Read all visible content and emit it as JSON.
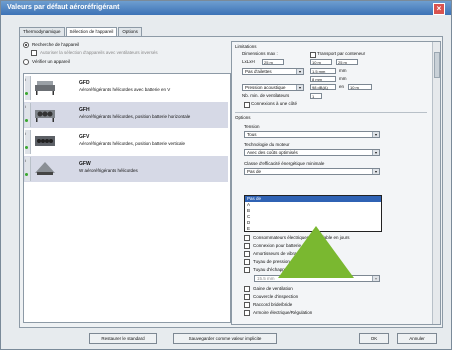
{
  "window": {
    "title": "Valeurs par défaut aéroréfrigérant"
  },
  "tabs": [
    {
      "label": "Thermodynamique"
    },
    {
      "label": "Sélection de l'appareil"
    },
    {
      "label": "Options"
    }
  ],
  "left": {
    "radio_search": "Recherche de l'appareil",
    "subcheck": "Autoriser la sélection d'appareils avec ventilateurs inversés",
    "radio_verify": "Vérifier un appareil",
    "items": [
      {
        "code": "GFD",
        "desc": "Aéroréfrigérants hélicoïdes avec batterie en V"
      },
      {
        "code": "GFH",
        "desc": "Aéroréfrigérants hélicoïdes, position batterie horizontale"
      },
      {
        "code": "GFV",
        "desc": "Aéroréfrigérants hélicoïdes, position batterie verticale"
      },
      {
        "code": "GFW",
        "desc": "W aéroréfrigérants hélicoïdes"
      }
    ]
  },
  "right": {
    "limits_title": "Limitations",
    "dim_max": "Dimensions max :",
    "transport": "Transport par conteneur",
    "lxlxh": "LxLxH",
    "v1": "25 m",
    "v2": "10 m",
    "v3": "25 m",
    "par_ailettes": "Pas d'ailettes",
    "pas_val": "1.5 mm",
    "mm1": "mm",
    "min_val": "8 mm",
    "mm2": "mm",
    "pression": "Pression acoustique",
    "press_val": "98 dB(A)",
    "at_label": "en",
    "dist_val": "10 m",
    "ventilateurs": "Nb. min. de ventilateurs",
    "vent_val": "1",
    "connexions": "Connexions à une côté",
    "options_title": "Options",
    "tension_label": "Tension",
    "tension_val": "Tous",
    "tech_label": "Technologie du moteur",
    "tech_val": "Avec des coûts optimisés",
    "class_label": "Classe d'efficacité énergétique minimale",
    "class_val": "Pas de",
    "dropdown": [
      "Pas de",
      "A",
      "B",
      "C",
      "D",
      "E"
    ],
    "checks": [
      "Consommateurs électriques contrôlable en jours",
      "Connexion pour batterie",
      "Amortisseurs de vibrations",
      "Tuyau de pression",
      "Tuyau d'échappement",
      "Gaine de ventilation",
      "Couvercle d'inspection",
      "Raccord bride/bride",
      "Armoire électrique/Régulation"
    ],
    "tuyau_val": "15.5 mm"
  },
  "buttons": {
    "restore": "Restaurer le standard",
    "save_default": "Sauvegarder comme valeur implicite",
    "ok": "OK",
    "cancel": "Annuler"
  },
  "colors": {
    "accent": "#2f62b4",
    "status_ok": "#3aa82f",
    "overlay_triangle": "#7ab830"
  }
}
